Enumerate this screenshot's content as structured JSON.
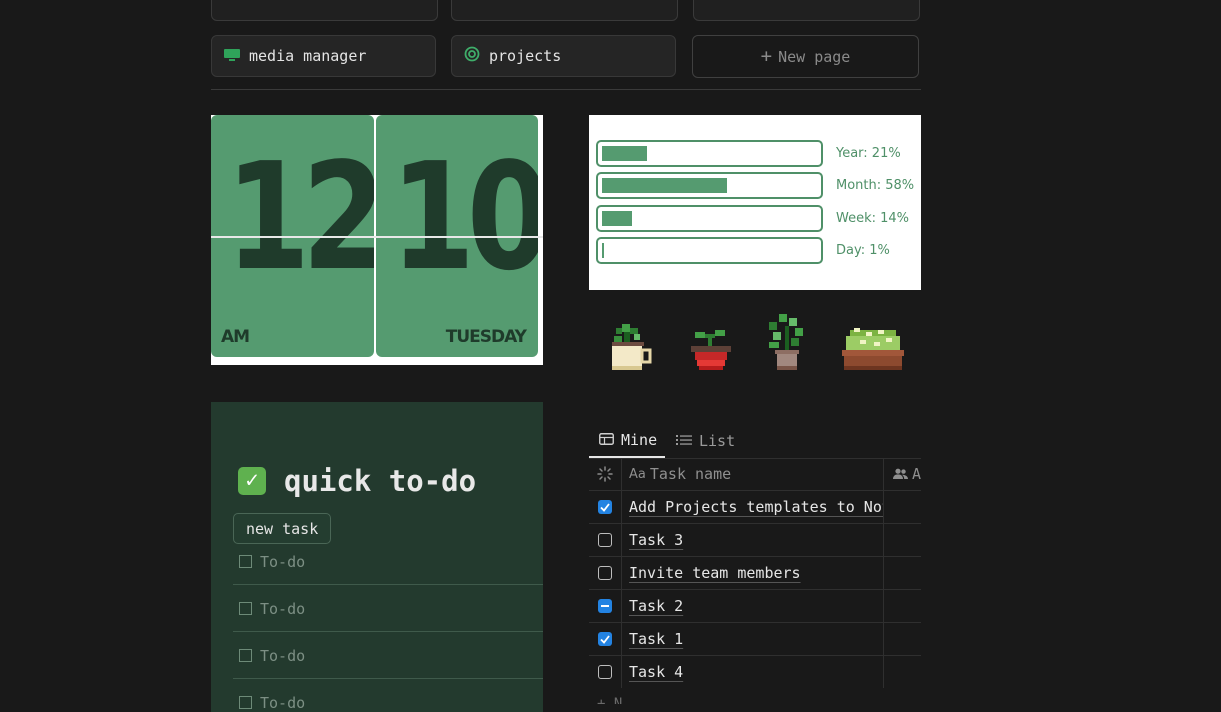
{
  "nav_buttons": [
    {
      "label": "media manager",
      "icon": "monitor-icon"
    },
    {
      "label": "projects",
      "icon": "target-icon"
    }
  ],
  "new_page": {
    "label": "New page",
    "icon": "plus-icon"
  },
  "clock": {
    "hour": "12",
    "minute": "10",
    "period": "AM",
    "day": "TUESDAY"
  },
  "progress": [
    {
      "label": "Year: 21%",
      "value": 21
    },
    {
      "label": "Month: 58%",
      "value": 58
    },
    {
      "label": "Week: 14%",
      "value": 14
    },
    {
      "label": "Day: 1%",
      "value": 1
    }
  ],
  "plants": [
    "potted-plant-mug-icon",
    "potted-plant-red-pot-icon",
    "potted-plant-tall-icon",
    "planter-box-icon"
  ],
  "todo": {
    "title": "quick to-do",
    "new_task_label": "new task",
    "items": [
      "To-do",
      "To-do",
      "To-do",
      "To-do"
    ]
  },
  "tasks": {
    "tabs": [
      {
        "label": "Mine",
        "icon": "table-icon"
      },
      {
        "label": "List",
        "icon": "list-icon"
      }
    ],
    "header": {
      "name_prefix": "Aa",
      "name": "Task name",
      "assignee": "A"
    },
    "rows": [
      {
        "name": "Add Projects templates to Notion",
        "status": "checked"
      },
      {
        "name": "Task 3",
        "status": "unchecked"
      },
      {
        "name": "Invite team members",
        "status": "unchecked"
      },
      {
        "name": "Task 2",
        "status": "partial"
      },
      {
        "name": "Task 1",
        "status": "checked"
      },
      {
        "name": "Task 4",
        "status": "unchecked"
      }
    ],
    "footer_label": "+ N"
  },
  "colors": {
    "accent_green": "#559b70",
    "checkbox_blue": "#2383e2",
    "todo_bg": "#233a2e"
  }
}
